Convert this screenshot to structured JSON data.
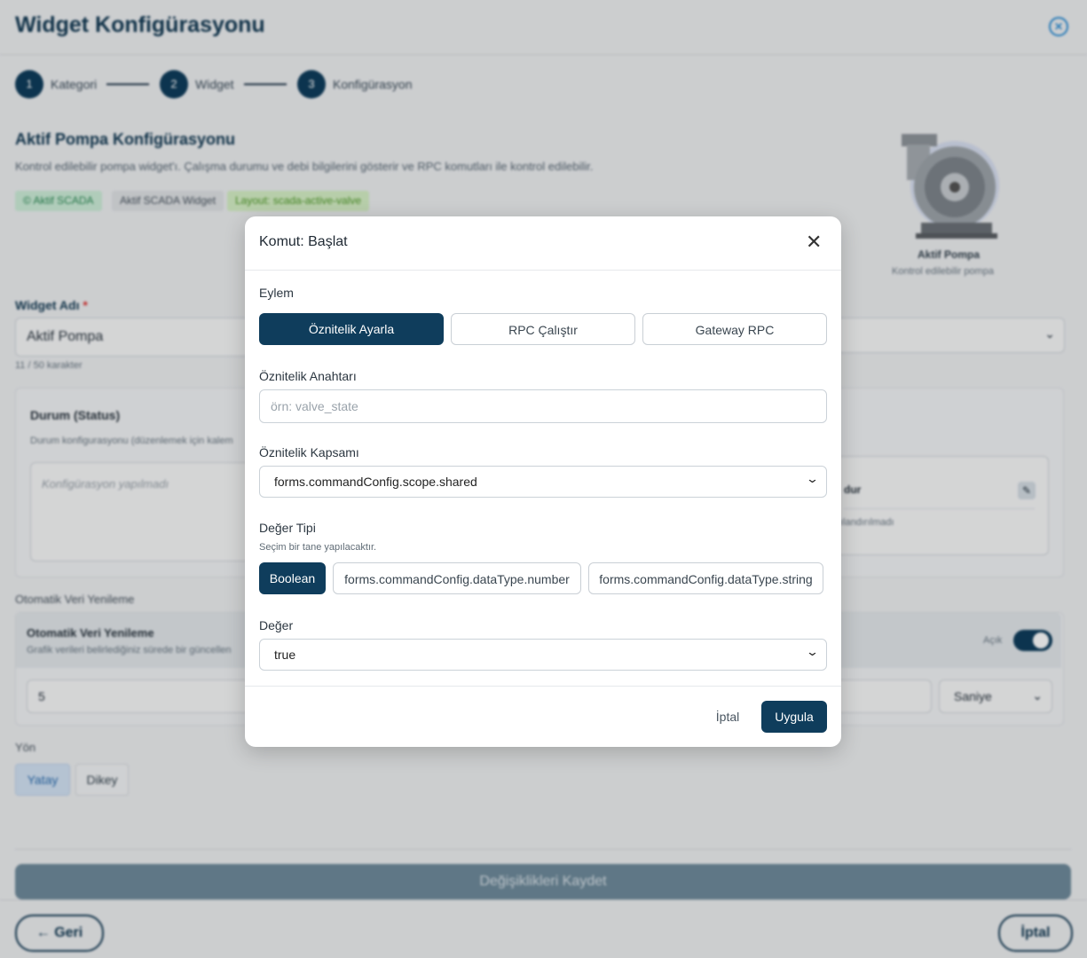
{
  "page": {
    "title": "Widget Konfigürasyonu",
    "steps": [
      {
        "number": "1",
        "label": "Kategori"
      },
      {
        "number": "2",
        "label": "Widget"
      },
      {
        "number": "3",
        "label": "Konfigürasyon"
      }
    ],
    "section_title": "Aktif Pompa Konfigürasyonu",
    "section_desc": "Kontrol edilebilir pompa widget'ı. Çalışma durumu ve debi bilgilerini gösterir ve RPC komutları ile kontrol edilebilir.",
    "badges": [
      "© Aktif SCADA",
      "Aktif SCADA Widget",
      "Layout: scada-active-valve"
    ],
    "preview_name": "Aktif Pompa",
    "preview_sub": "Kontrol edilebilir pompa",
    "widget_name_label": "Widget Adı",
    "required_mark": "*",
    "widget_name_value": "Aktif Pompa",
    "char_count": "11 / 50 karakter",
    "status_title": "Durum (Status)",
    "status_desc": "Durum konfigurasyonu (düzenlemek için kalem",
    "status_empty": "Konfigürasyon yapılmadı",
    "right_card_title": "dur",
    "right_card_sub": "ılandırılmadı",
    "auto_refresh_label": "Otomatik Veri Yenileme",
    "auto_refresh_title": "Otomatik Veri Yenileme",
    "auto_refresh_desc": "Grafik verileri belirlediğiniz sürede bir güncellen",
    "toggle_label": "Açık",
    "refresh_value": "5",
    "refresh_unit": "Saniye",
    "direction_label": "Yön",
    "dir_options": [
      "Yatay",
      "Dikey"
    ],
    "save_button": "Değişiklikleri Kaydet",
    "back_button": "← Geri",
    "cancel_button": "İptal"
  },
  "modal": {
    "title": "Komut: Başlat",
    "action_label": "Eylem",
    "actions": [
      "Öznitelik Ayarla",
      "RPC Çalıştır",
      "Gateway RPC"
    ],
    "attr_key_label": "Öznitelik Anahtarı",
    "attr_key_placeholder": "örn: valve_state",
    "attr_scope_label": "Öznitelik Kapsamı",
    "attr_scope_value": "forms.commandConfig.scope.shared",
    "value_type_label": "Değer Tipi",
    "value_type_hint": "Seçim bir tane yapılacaktır.",
    "value_types": [
      "Boolean",
      "forms.commandConfig.dataType.number",
      "forms.commandConfig.dataType.string"
    ],
    "value_label": "Değer",
    "value_value": "true",
    "cancel_label": "İptal",
    "apply_label": "Uygula"
  },
  "colors": {
    "primary": "#0f3d5c",
    "accent": "#2d8fd6",
    "badge_green_bg": "#cdeed9",
    "badge_green_text": "#2e8b57"
  },
  "icons": [
    "close-circle-icon",
    "close-icon",
    "edit-pencil-icon",
    "chevron-down-icon"
  ]
}
